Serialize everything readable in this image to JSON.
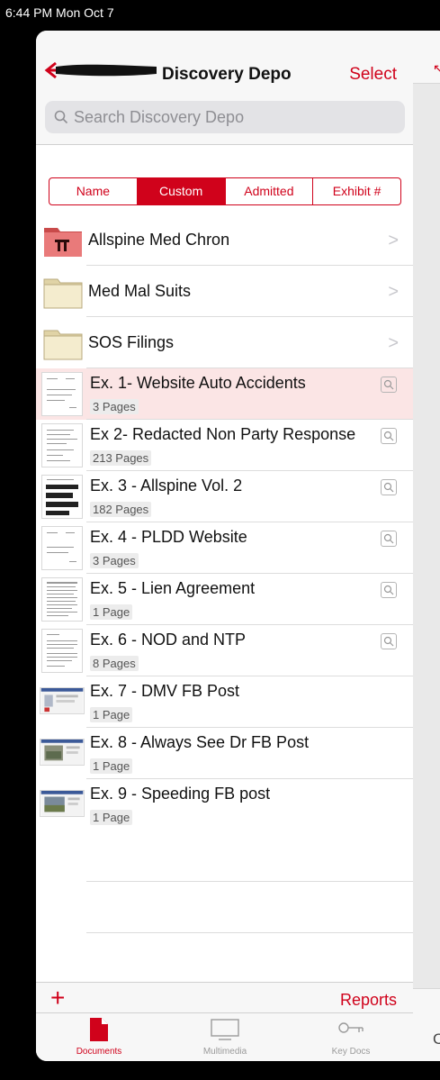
{
  "status_bar": {
    "time_date": "6:44 PM   Mon Oct 7"
  },
  "nav": {
    "title": "Discovery Depo",
    "select_label": "Select",
    "back_icon": "back-arrow-icon"
  },
  "search": {
    "placeholder": "Search Discovery Depo"
  },
  "segments": [
    {
      "label": "Name",
      "active": false
    },
    {
      "label": "Custom",
      "active": true
    },
    {
      "label": "Admitted",
      "active": false
    },
    {
      "label": "Exhibit #",
      "active": false
    }
  ],
  "folders": [
    {
      "name": "Allspine Med Chron",
      "icon": "folder-red-icon"
    },
    {
      "name": "Med Mal Suits",
      "icon": "folder-icon"
    },
    {
      "name": "SOS Filings",
      "icon": "folder-icon"
    }
  ],
  "documents": [
    {
      "name": "Ex. 1- Website Auto Accidents",
      "pages": "3 Pages",
      "selected": true,
      "preview": true
    },
    {
      "name": "Ex 2- Redacted Non Party Response",
      "pages": "213 Pages",
      "selected": false,
      "preview": true
    },
    {
      "name": "Ex. 3 - Allspine Vol. 2",
      "pages": "182 Pages",
      "selected": false,
      "preview": true
    },
    {
      "name": "Ex. 4 - PLDD Website",
      "pages": "3 Pages",
      "selected": false,
      "preview": true
    },
    {
      "name": "Ex. 5 - Lien Agreement",
      "pages": "1 Page",
      "selected": false,
      "preview": true
    },
    {
      "name": "Ex. 6 - NOD and NTP",
      "pages": "8 Pages",
      "selected": false,
      "preview": true
    },
    {
      "name": "Ex. 7 - DMV FB Post",
      "pages": "1 Page",
      "selected": false,
      "preview": false
    },
    {
      "name": "Ex. 8 - Always See Dr FB Post",
      "pages": "1 Page",
      "selected": false,
      "preview": false
    },
    {
      "name": "Ex. 9 - Speeding FB post",
      "pages": "1 Page",
      "selected": false,
      "preview": false
    }
  ],
  "toolbar": {
    "add_label": "+",
    "reports_label": "Reports"
  },
  "tabs": [
    {
      "label": "Documents",
      "icon": "document-icon",
      "active": true
    },
    {
      "label": "Multimedia",
      "icon": "monitor-icon",
      "active": false
    },
    {
      "label": "Key Docs",
      "icon": "key-icon",
      "active": false
    }
  ],
  "right_pane": {
    "bottom_char": "C"
  },
  "colors": {
    "accent": "#d0021b",
    "selected_row": "#fbe5e5"
  }
}
